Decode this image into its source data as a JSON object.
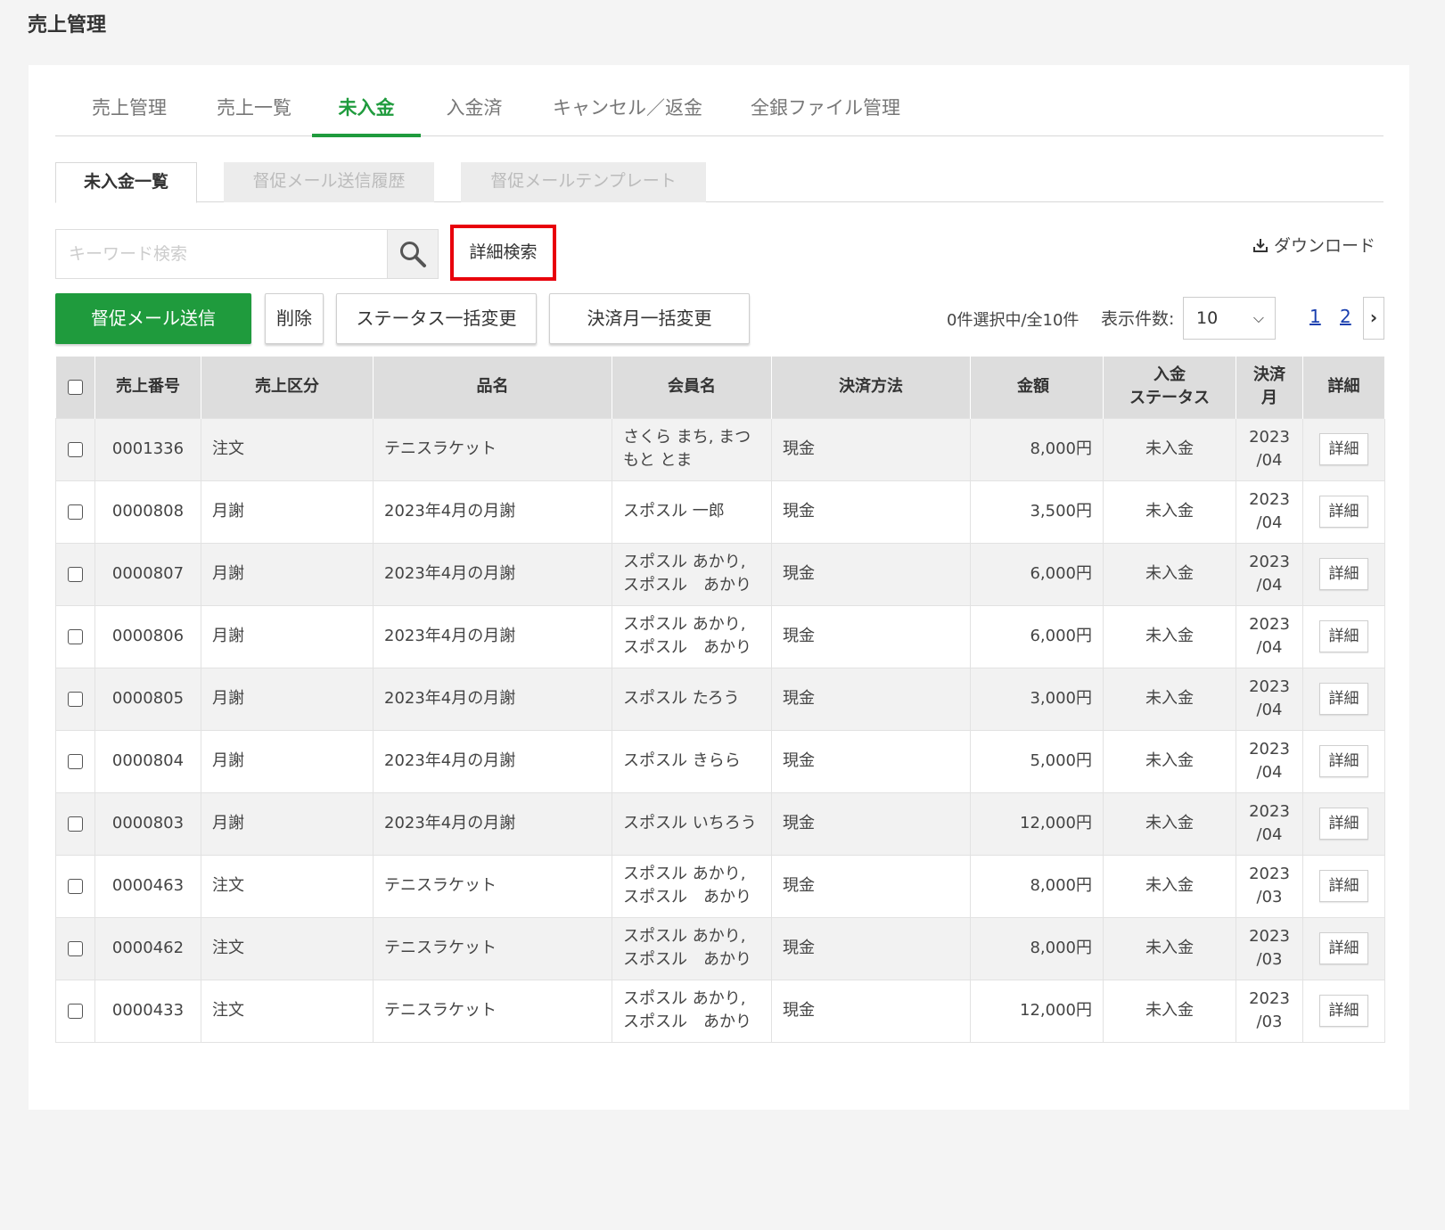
{
  "page_title": "売上管理",
  "main_tabs": [
    {
      "label": "売上管理"
    },
    {
      "label": "売上一覧"
    },
    {
      "label": "未入金"
    },
    {
      "label": "入金済"
    },
    {
      "label": "キャンセル／返金"
    },
    {
      "label": "全銀ファイル管理"
    }
  ],
  "active_main_tab": "未入金",
  "sub_tabs": [
    {
      "label": "未入金一覧"
    },
    {
      "label": "督促メール送信履歴"
    },
    {
      "label": "督促メールテンプレート"
    }
  ],
  "search": {
    "placeholder": "キーワード検索",
    "value": ""
  },
  "advanced_search_label": "詳細検索",
  "download_label": "ダウンロード",
  "actions": {
    "send_reminder": "督促メール送信",
    "delete": "削除",
    "bulk_status": "ステータス一括変更",
    "bulk_month": "決済月一括変更"
  },
  "selection_info": "0件選択中/全10件",
  "per_page": {
    "label": "表示件数:",
    "value": "10"
  },
  "pagination": [
    "1",
    "2"
  ],
  "colors": {
    "accent": "#1f9b3d",
    "member_link": "#2aa84a",
    "highlight": "#e8000b"
  },
  "table": {
    "headers": {
      "sales_no": "売上番号",
      "category": "売上区分",
      "item": "品名",
      "member": "会員名",
      "payment": "決済方法",
      "amount": "金額",
      "status_l1": "入金",
      "status_l2": "ステータス",
      "month_l1": "決済",
      "month_l2": "月",
      "detail": "詳細"
    },
    "rows": [
      {
        "no": "0001336",
        "category": "注文",
        "item": "テニスラケット",
        "member_l1": "さくら まち, まつ",
        "member_l2": "もと とま",
        "payment": "現金",
        "amount": "8,000円",
        "status": "未入金",
        "year": "2023",
        "month": "/04",
        "detail": "詳細"
      },
      {
        "no": "0000808",
        "category": "月謝",
        "item": "2023年4月の月謝",
        "member_l1": "スポスル 一郎",
        "member_l2": "",
        "payment": "現金",
        "amount": "3,500円",
        "status": "未入金",
        "year": "2023",
        "month": "/04",
        "detail": "詳細"
      },
      {
        "no": "0000807",
        "category": "月謝",
        "item": "2023年4月の月謝",
        "member_l1": "スポスル あかり,",
        "member_l2": "スポスル　あかり",
        "payment": "現金",
        "amount": "6,000円",
        "status": "未入金",
        "year": "2023",
        "month": "/04",
        "detail": "詳細"
      },
      {
        "no": "0000806",
        "category": "月謝",
        "item": "2023年4月の月謝",
        "member_l1": "スポスル あかり,",
        "member_l2": "スポスル　あかり",
        "payment": "現金",
        "amount": "6,000円",
        "status": "未入金",
        "year": "2023",
        "month": "/04",
        "detail": "詳細"
      },
      {
        "no": "0000805",
        "category": "月謝",
        "item": "2023年4月の月謝",
        "member_l1": "スポスル たろう",
        "member_l2": "",
        "payment": "現金",
        "amount": "3,000円",
        "status": "未入金",
        "year": "2023",
        "month": "/04",
        "detail": "詳細"
      },
      {
        "no": "0000804",
        "category": "月謝",
        "item": "2023年4月の月謝",
        "member_l1": "スポスル きらら",
        "member_l2": "",
        "payment": "現金",
        "amount": "5,000円",
        "status": "未入金",
        "year": "2023",
        "month": "/04",
        "detail": "詳細"
      },
      {
        "no": "0000803",
        "category": "月謝",
        "item": "2023年4月の月謝",
        "member_l1": "スポスル いちろう",
        "member_l2": "",
        "payment": "現金",
        "amount": "12,000円",
        "status": "未入金",
        "year": "2023",
        "month": "/04",
        "detail": "詳細"
      },
      {
        "no": "0000463",
        "category": "注文",
        "item": "テニスラケット",
        "member_l1": "スポスル あかり,",
        "member_l2": "スポスル　あかり",
        "payment": "現金",
        "amount": "8,000円",
        "status": "未入金",
        "year": "2023",
        "month": "/03",
        "detail": "詳細"
      },
      {
        "no": "0000462",
        "category": "注文",
        "item": "テニスラケット",
        "member_l1": "スポスル あかり,",
        "member_l2": "スポスル　あかり",
        "payment": "現金",
        "amount": "8,000円",
        "status": "未入金",
        "year": "2023",
        "month": "/03",
        "detail": "詳細"
      },
      {
        "no": "0000433",
        "category": "注文",
        "item": "テニスラケット",
        "member_l1": "スポスル あかり,",
        "member_l2": "スポスル　あかり",
        "payment": "現金",
        "amount": "12,000円",
        "status": "未入金",
        "year": "2023",
        "month": "/03",
        "detail": "詳細"
      }
    ]
  }
}
